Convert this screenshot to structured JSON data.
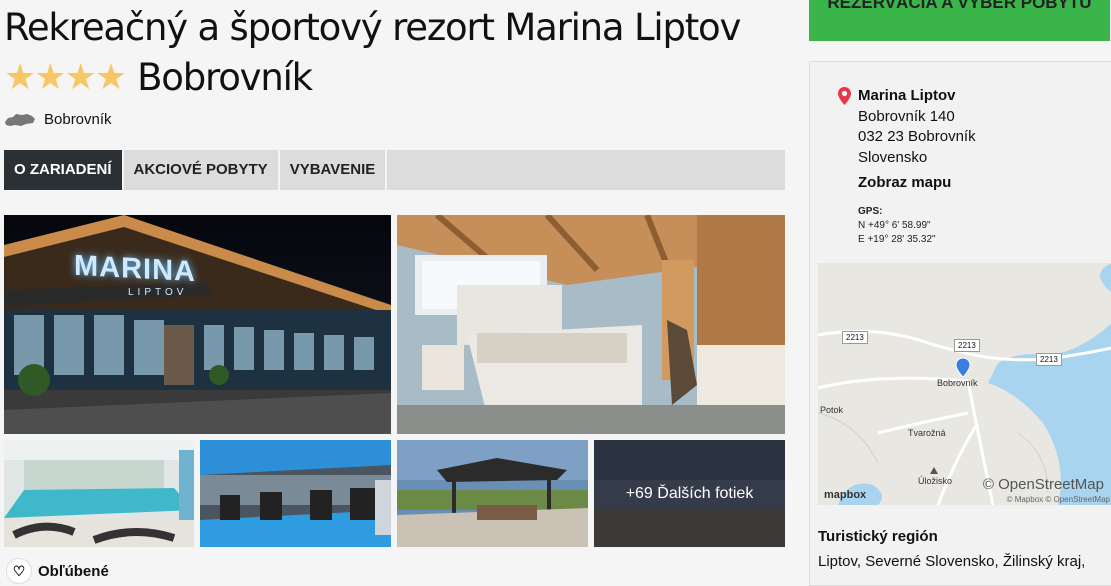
{
  "header": {
    "title_line1": "Rekreačný a športový rezort Marina Liptov",
    "stars": "★★★★",
    "star_rating": 4,
    "title_line2": "Bobrovník",
    "location": "Bobrovník"
  },
  "tabs": [
    {
      "label": "O ZARIADENÍ",
      "active": true
    },
    {
      "label": "AKCIOVÉ POBYTY",
      "active": false
    },
    {
      "label": "VYBAVENIE",
      "active": false
    }
  ],
  "gallery": {
    "more_photos": "+69 Ďalších fotiek",
    "sign_text": "MARINA",
    "sign_subtext": "LIPTOV"
  },
  "favorites": {
    "label": "Obľúbené"
  },
  "sidebar": {
    "book_button": "REZERVÁCIA A VÝBER POBYTU",
    "address": {
      "name": "Marina Liptov",
      "street": "Bobrovník 140",
      "city": "032 23 Bobrovník",
      "country": "Slovensko"
    },
    "show_map": "Zobraz mapu",
    "gps": {
      "label": "GPS:",
      "north": "N +49° 6' 58.99\"",
      "east": "E +19° 28' 35.32\""
    },
    "map": {
      "road1": "2213",
      "road2": "2213",
      "road3": "2213",
      "place_bobrovnik": "Bobrovník",
      "place_potok": "Potok",
      "place_tvarozna": "Tvarožná",
      "place_ulozisko": "Úložisko",
      "osm": "© OpenStreetMap",
      "mapbox": "mapbox",
      "credits": "© Mapbox © OpenStreetMap"
    },
    "region_title": "Turistický región",
    "region_text": "Liptov, Severné Slovensko, Žilinský kraj,"
  },
  "colors": {
    "accent_green": "#39b54a",
    "active_tab": "#2b3035",
    "stars": "#f7c766",
    "pin": "#e8364a"
  }
}
